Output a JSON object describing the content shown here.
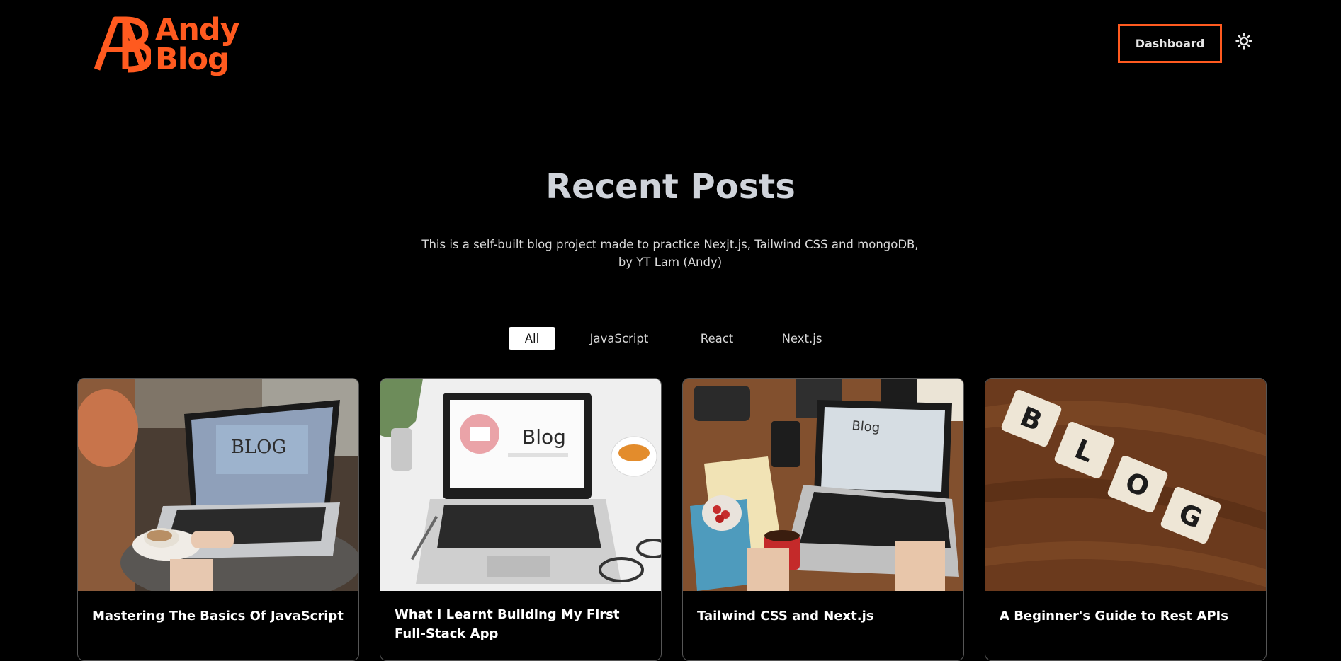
{
  "header": {
    "logo_text_line1": "Andy",
    "logo_text_line2": "Blog",
    "dashboard_label": "Dashboard",
    "theme_icon": "sun-icon"
  },
  "hero": {
    "title": "Recent Posts",
    "description": "This is a self-built blog project made to practice Nexjt.js, Tailwind CSS and mongoDB, by YT Lam (Andy)"
  },
  "filters": [
    {
      "label": "All",
      "active": true
    },
    {
      "label": "JavaScript",
      "active": false
    },
    {
      "label": "React",
      "active": false
    },
    {
      "label": "Next.js",
      "active": false
    }
  ],
  "posts": [
    {
      "title": "Mastering The Basics Of JavaScript"
    },
    {
      "title": "What I Learnt Building My First Full-Stack App"
    },
    {
      "title": "Tailwind CSS and Next.js"
    },
    {
      "title": "A Beginner's Guide to Rest APIs"
    }
  ],
  "colors": {
    "accent": "#ff5a1f",
    "background": "#000000",
    "card_border": "#555555"
  }
}
